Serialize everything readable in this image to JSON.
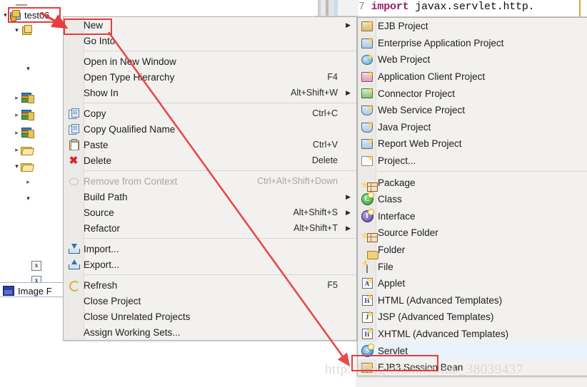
{
  "editor": {
    "line_number": "7",
    "keyword": "import",
    "code_text": " javax.servlet.http."
  },
  "tree": {
    "project_label": "test06",
    "selected_file_label": "Image F",
    "nodes": [
      {
        "name": "project-test06",
        "label": "test06",
        "icon": "java-project-icon",
        "expander": "expanded"
      },
      {
        "name": "package-node",
        "label": "",
        "icon": "package-icon",
        "expander": "expanded"
      },
      {
        "name": "node-3",
        "label": "",
        "icon": "",
        "expander": "expanded"
      },
      {
        "name": "library-node-1",
        "label": "",
        "icon": "library-icon",
        "expander": "collapsed"
      },
      {
        "name": "library-node-2",
        "label": "",
        "icon": "library-icon",
        "expander": "collapsed"
      },
      {
        "name": "library-node-3",
        "label": "",
        "icon": "library-icon",
        "expander": "collapsed"
      },
      {
        "name": "folder-node-1",
        "label": "",
        "icon": "folder-icon",
        "expander": "collapsed"
      },
      {
        "name": "folder-node-2",
        "label": "",
        "icon": "folder-icon",
        "expander": "expanded"
      },
      {
        "name": "node-9",
        "label": "",
        "icon": "",
        "expander": "collapsed"
      },
      {
        "name": "node-10",
        "label": "",
        "icon": "",
        "expander": "expanded"
      },
      {
        "name": "xml-node-1",
        "label": "",
        "icon": "xml-file-icon",
        "expander": ""
      },
      {
        "name": "xml-node-2",
        "label": "",
        "icon": "xml-file-icon",
        "expander": ""
      }
    ]
  },
  "context_menu": {
    "items": [
      {
        "label": "New",
        "accel": "",
        "submenu": true,
        "icon": "",
        "disabled": false,
        "highlighted": true
      },
      {
        "label": "Go Into",
        "accel": "",
        "submenu": false,
        "icon": "",
        "disabled": false
      },
      {
        "separator": true
      },
      {
        "label": "Open in New Window",
        "accel": "",
        "submenu": false,
        "icon": "",
        "disabled": false
      },
      {
        "label": "Open Type Hierarchy",
        "accel": "F4",
        "submenu": false,
        "icon": "",
        "disabled": false
      },
      {
        "label": "Show In",
        "accel": "Alt+Shift+W",
        "submenu": true,
        "icon": "",
        "disabled": false
      },
      {
        "separator": true
      },
      {
        "label": "Copy",
        "accel": "Ctrl+C",
        "submenu": false,
        "icon": "copy-icon",
        "disabled": false
      },
      {
        "label": "Copy Qualified Name",
        "accel": "",
        "submenu": false,
        "icon": "copy-qualified-icon",
        "disabled": false
      },
      {
        "label": "Paste",
        "accel": "Ctrl+V",
        "submenu": false,
        "icon": "paste-icon",
        "disabled": false
      },
      {
        "label": "Delete",
        "accel": "Delete",
        "submenu": false,
        "icon": "delete-icon",
        "disabled": false
      },
      {
        "separator": true
      },
      {
        "label": "Remove from Context",
        "accel": "Ctrl+Alt+Shift+Down",
        "submenu": false,
        "icon": "remove-context-icon",
        "disabled": true
      },
      {
        "label": "Build Path",
        "accel": "",
        "submenu": true,
        "icon": "",
        "disabled": false
      },
      {
        "label": "Source",
        "accel": "Alt+Shift+S",
        "submenu": true,
        "icon": "",
        "disabled": false
      },
      {
        "label": "Refactor",
        "accel": "Alt+Shift+T",
        "submenu": true,
        "icon": "",
        "disabled": false
      },
      {
        "separator": true
      },
      {
        "label": "Import...",
        "accel": "",
        "submenu": false,
        "icon": "import-icon",
        "disabled": false
      },
      {
        "label": "Export...",
        "accel": "",
        "submenu": false,
        "icon": "export-icon",
        "disabled": false
      },
      {
        "separator": true
      },
      {
        "label": "Refresh",
        "accel": "F5",
        "submenu": false,
        "icon": "refresh-icon",
        "disabled": false
      },
      {
        "label": "Close Project",
        "accel": "",
        "submenu": false,
        "icon": "",
        "disabled": false
      },
      {
        "label": "Close Unrelated Projects",
        "accel": "",
        "submenu": false,
        "icon": "",
        "disabled": false
      },
      {
        "label": "Assign Working Sets...",
        "accel": "",
        "submenu": false,
        "icon": "",
        "disabled": false
      }
    ]
  },
  "new_submenu": {
    "items": [
      {
        "label": "EJB Project",
        "icon": "ejb-project-icon"
      },
      {
        "label": "Enterprise Application Project",
        "icon": "enterprise-app-project-icon"
      },
      {
        "label": "Web Project",
        "icon": "web-project-icon"
      },
      {
        "label": "Application Client Project",
        "icon": "app-client-project-icon"
      },
      {
        "label": "Connector Project",
        "icon": "connector-project-icon"
      },
      {
        "label": "Web Service Project",
        "icon": "web-service-project-icon"
      },
      {
        "label": "Java Project",
        "icon": "java-project-icon"
      },
      {
        "label": "Report Web Project",
        "icon": "report-web-project-icon"
      },
      {
        "label": "Project...",
        "icon": "generic-project-icon"
      },
      {
        "separator": true
      },
      {
        "label": "Package",
        "icon": "package-icon"
      },
      {
        "label": "Class",
        "icon": "class-icon"
      },
      {
        "label": "Interface",
        "icon": "interface-icon"
      },
      {
        "label": "Source Folder",
        "icon": "source-folder-icon"
      },
      {
        "label": "Folder",
        "icon": "folder-icon"
      },
      {
        "label": "File",
        "icon": "file-icon"
      },
      {
        "label": "Applet",
        "icon": "applet-icon"
      },
      {
        "label": "HTML (Advanced Templates)",
        "icon": "html-icon"
      },
      {
        "label": "JSP (Advanced Templates)",
        "icon": "jsp-icon"
      },
      {
        "label": "XHTML (Advanced Templates)",
        "icon": "xhtml-icon"
      },
      {
        "label": "Servlet",
        "icon": "servlet-icon",
        "highlighted": true
      },
      {
        "label": "EJB3 Session Bean",
        "icon": "ejb3-session-bean-icon"
      }
    ]
  },
  "annotations": {
    "accent_color": "#e83b3b",
    "highlight_boxes": [
      "project-test06",
      "menu-item-new",
      "submenu-item-servlet"
    ],
    "arrows": [
      "test06-to-new",
      "new-to-servlet"
    ]
  },
  "watermark": {
    "text": "http://blog.csdn.net/m0_38039437"
  }
}
